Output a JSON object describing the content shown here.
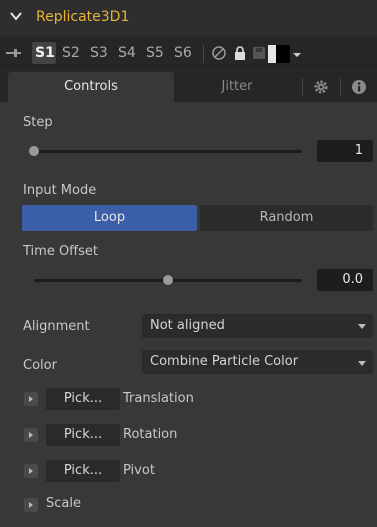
{
  "title": "Replicate3D1",
  "versions": [
    "S1",
    "S2",
    "S3",
    "S4",
    "S5",
    "S6"
  ],
  "selected_version": "S1",
  "tabs": {
    "controls": "Controls",
    "jitter": "Jitter"
  },
  "step": {
    "label": "Step",
    "value": "1",
    "slider_fraction": 0.0
  },
  "input_mode": {
    "label": "Input Mode",
    "options": [
      "Loop",
      "Random"
    ],
    "selected": "Loop"
  },
  "time_offset": {
    "label": "Time Offset",
    "value": "0.0",
    "slider_fraction": 0.5
  },
  "alignment": {
    "label": "Alignment",
    "value": "Not aligned"
  },
  "color": {
    "label": "Color",
    "value": "Combine Particle Color"
  },
  "pick_rows": [
    {
      "button": "Pick...",
      "label": "Translation"
    },
    {
      "button": "Pick...",
      "label": "Rotation"
    },
    {
      "button": "Pick...",
      "label": "Pivot"
    }
  ],
  "scale": {
    "label": "Scale"
  },
  "colors": {
    "title": "#e8b23c",
    "accent": "#3b5fa6",
    "panel": "#383838"
  }
}
